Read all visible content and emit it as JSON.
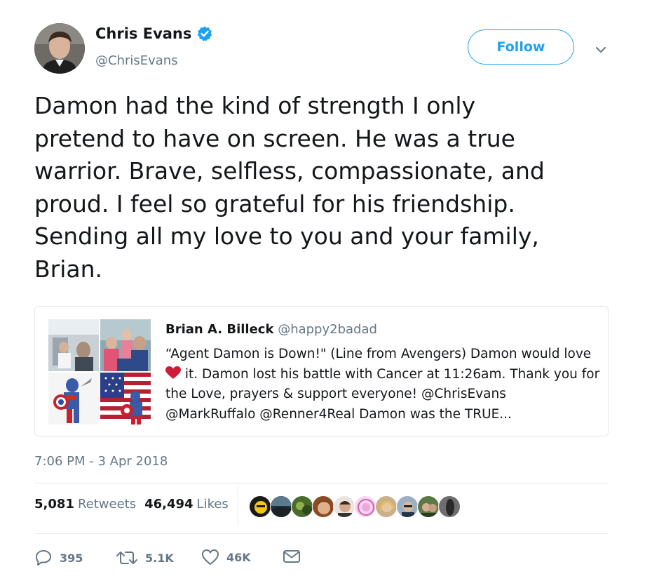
{
  "author": {
    "name": "Chris Evans",
    "handle": "@ChrisEvans",
    "verified": true
  },
  "follow_button": {
    "label": "Follow"
  },
  "tweet": {
    "text": "Damon had the kind of strength I only\npretend to have on screen. He was a true\nwarrior. Brave, selfless, compassionate, and\nproud. I feel so grateful for his friendship.\nSending all my love to you and your family,\nBrian."
  },
  "quoted_tweet": {
    "name": "Brian A. Billeck",
    "handle": "@happy2badad",
    "text_before_heart": "“Agent Damon is Down!\" (Line from Avengers) Damon would love",
    "text_after_heart": " it. Damon lost his battle with Cancer at 11:26am. Thank you for the Love,  prayers & support everyone! @ChrisEvans @MarkRuffalo @Renner4Real Damon was the TRUE..."
  },
  "timestamp": "7:06 PM - 3 Apr 2018",
  "stats": {
    "retweets_count": "5,081",
    "retweets_label": "Retweets",
    "likes_count": "46,494",
    "likes_label": "Likes"
  },
  "actions": {
    "reply_count": "395",
    "retweet_count": "5.1K",
    "like_count": "46K"
  },
  "colors": {
    "accent": "#1da1f2",
    "text": "#14171a",
    "muted": "#657786",
    "heart": "#e0245e",
    "border": "#e1e8ed"
  },
  "icons": [
    "verified-badge-icon",
    "chevron-down-icon",
    "heart-emoji-icon",
    "reply-icon",
    "retweet-icon",
    "like-icon",
    "direct-message-icon"
  ]
}
